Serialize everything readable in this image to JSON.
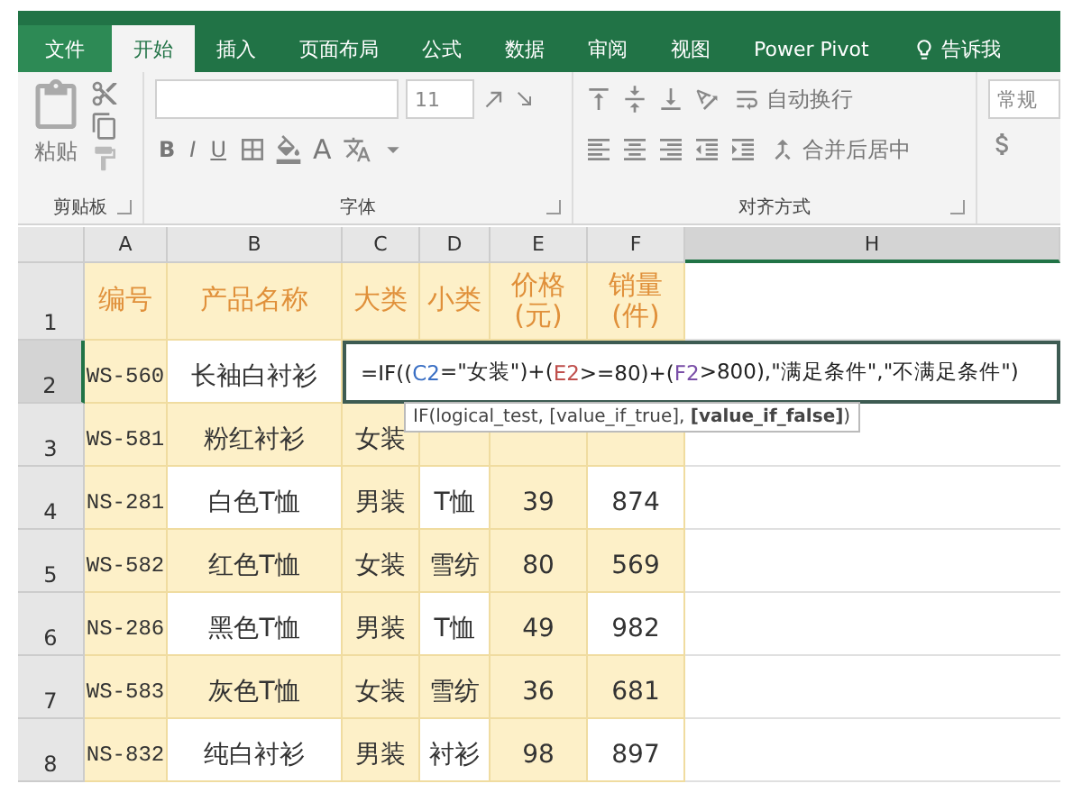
{
  "tabs": [
    {
      "label": "文件",
      "kind": "file",
      "selected": false
    },
    {
      "label": "开始",
      "kind": "tab",
      "selected": true
    },
    {
      "label": "插入",
      "kind": "tab",
      "selected": false
    },
    {
      "label": "页面布局",
      "kind": "tab",
      "selected": false
    },
    {
      "label": "公式",
      "kind": "tab",
      "selected": false
    },
    {
      "label": "数据",
      "kind": "tab",
      "selected": false
    },
    {
      "label": "审阅",
      "kind": "tab",
      "selected": false
    },
    {
      "label": "视图",
      "kind": "tab",
      "selected": false
    },
    {
      "label": "Power Pivot",
      "kind": "tab",
      "selected": false
    },
    {
      "label": "告诉我",
      "kind": "tell",
      "selected": false
    }
  ],
  "ribbon": {
    "clipboard": {
      "label": "剪贴板",
      "paste": "粘贴"
    },
    "font": {
      "label": "字体",
      "size": "11",
      "bold": "B",
      "italic": "I",
      "underline": "U",
      "font_color": "A"
    },
    "alignment": {
      "label": "对齐方式",
      "wrap": "自动换行",
      "merge": "合并后居中"
    },
    "number": {
      "format": "常规"
    }
  },
  "sheet": {
    "columns": [
      {
        "label": "A",
        "selected": false
      },
      {
        "label": "B",
        "selected": false
      },
      {
        "label": "C",
        "selected": false
      },
      {
        "label": "D",
        "selected": false
      },
      {
        "label": "E",
        "selected": false
      },
      {
        "label": "F",
        "selected": false
      },
      {
        "label": "H",
        "selected": true
      }
    ],
    "rows": [
      {
        "number": "1",
        "kind": "header",
        "selected": false,
        "cells": [
          "编号",
          "产品名称",
          "大类",
          "小类",
          "价格\n(元)",
          "销量\n(件)"
        ]
      },
      {
        "number": "2",
        "kind": "editing",
        "selected": true,
        "cells": [
          "WS-560",
          "长袖白衬衫"
        ],
        "editor": {
          "segments": [
            {
              "text": "=IF((",
              "color": "#222222"
            },
            {
              "text": "C2",
              "color": "#3a6fc4"
            },
            {
              "text": "=\"女装\")+(",
              "color": "#222222"
            },
            {
              "text": "E2",
              "color": "#c0504d"
            },
            {
              "text": ">=80)+(",
              "color": "#222222"
            },
            {
              "text": "F2",
              "color": "#7a4fa8"
            },
            {
              "text": ">800),\"满足条件\",\"不满足条件\")",
              "color": "#222222"
            }
          ],
          "tooltip": "IF(logical_test, [value_if_true], **[value_if_false]**)"
        }
      },
      {
        "number": "3",
        "kind": "data",
        "selected": false,
        "cells": [
          "WS-581",
          "粉红衬衫",
          "女装"
        ]
      },
      {
        "number": "4",
        "kind": "data",
        "selected": false,
        "cells": [
          "NS-281",
          "白色T恤",
          "男装",
          "T恤",
          "39",
          "874"
        ]
      },
      {
        "number": "5",
        "kind": "data",
        "selected": false,
        "cells": [
          "WS-582",
          "红色T恤",
          "女装",
          "雪纺",
          "80",
          "569"
        ]
      },
      {
        "number": "6",
        "kind": "data",
        "selected": false,
        "cells": [
          "NS-286",
          "黑色T恤",
          "男装",
          "T恤",
          "49",
          "982"
        ]
      },
      {
        "number": "7",
        "kind": "data",
        "selected": false,
        "cells": [
          "WS-583",
          "灰色T恤",
          "女装",
          "雪纺",
          "36",
          "681"
        ]
      },
      {
        "number": "8",
        "kind": "data",
        "selected": false,
        "cells": [
          "NS-832",
          "纯白衬衫",
          "男装",
          "衬衫",
          "98",
          "897"
        ]
      }
    ]
  }
}
